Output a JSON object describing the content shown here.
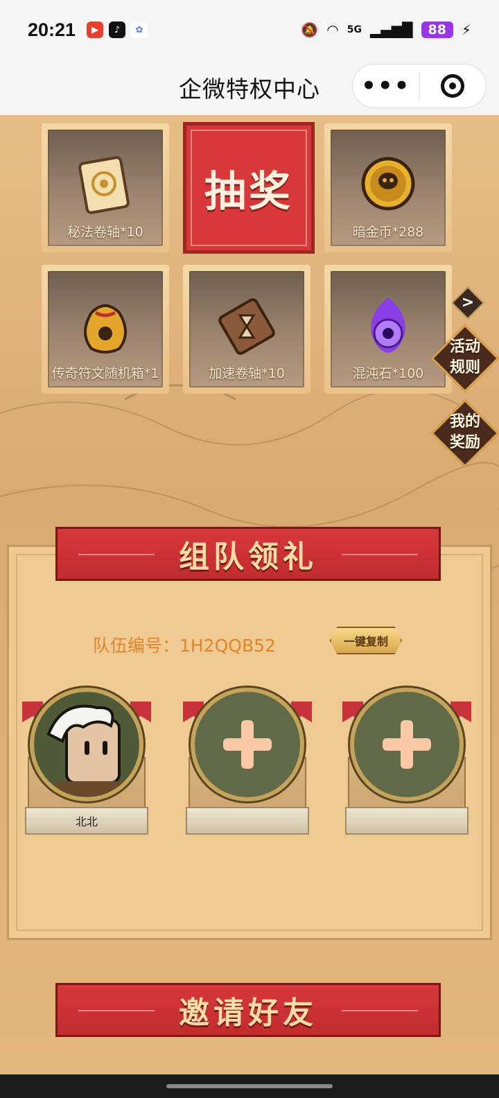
{
  "status_bar": {
    "time": "20:21",
    "network": "5G",
    "battery": "88"
  },
  "title_bar": {
    "title": "企微特权中心",
    "more_label": "•••"
  },
  "prizes": [
    {
      "name": "scroll-arcane",
      "label": "秘法卷轴*10",
      "icon": "scroll-icon"
    },
    {
      "name": "dark-gold",
      "label": "暗金币*288",
      "icon": "skull-coin-icon"
    },
    {
      "name": "legend-rune-box",
      "label": "传奇符文随机箱*1",
      "icon": "bag-icon"
    },
    {
      "name": "speed-scroll",
      "label": "加速卷轴*10",
      "icon": "hourglass-scroll-icon"
    },
    {
      "name": "chaos-stone",
      "label": "混沌石*100",
      "icon": "purple-orb-icon"
    }
  ],
  "draw_button": {
    "label": "抽奖"
  },
  "next_arrow": {
    "label": ">"
  },
  "side_buttons": {
    "rules": "活动\n规则",
    "rewards": "我的\n奖励"
  },
  "team": {
    "header": "组队领礼",
    "team_id_label": "队伍编号：1H2QQB52",
    "copy_label": "一键复制",
    "members": [
      {
        "name": "北北",
        "filled": true
      },
      {
        "name": "",
        "filled": false
      },
      {
        "name": "",
        "filled": false
      }
    ]
  },
  "invite": {
    "header": "邀请好友"
  },
  "colors": {
    "ribbon_red": "#d8383a",
    "team_id_orange": "#e0852c",
    "card_bg": "#efcb93"
  }
}
